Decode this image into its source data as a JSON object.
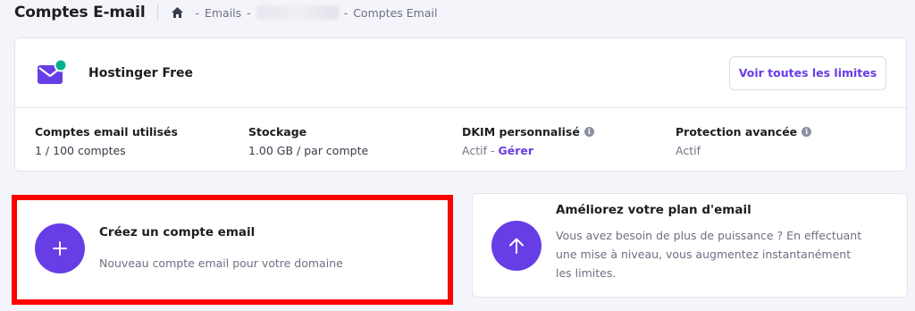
{
  "header": {
    "title": "Comptes E-mail",
    "breadcrumb": {
      "home_icon": "home-icon",
      "items": [
        "Emails",
        "Comptes Email"
      ],
      "separator": "-"
    }
  },
  "plan": {
    "icon": "mail-icon",
    "name": "Hostinger Free",
    "limits_button": "Voir toutes les limites",
    "stats": [
      {
        "label": "Comptes email utilisés",
        "value": "1 / 100 comptes"
      },
      {
        "label": "Stockage",
        "value": "1.00 GB / par compte"
      },
      {
        "label": "DKIM personnalisé",
        "value": "Actif",
        "link": "Gérer"
      },
      {
        "label": "Protection avancée",
        "value": "Actif"
      }
    ]
  },
  "create_card": {
    "icon": "plus-icon",
    "title": "Créez un compte email",
    "description": "Nouveau compte email pour votre domaine"
  },
  "upgrade_card": {
    "icon": "arrow-up-icon",
    "title": "Améliorez votre plan d'email",
    "description": "Vous avez besoin de plus de puissance ? En effectuant une mise à niveau, vous augmentez instantanément les limites."
  },
  "colors": {
    "accent": "#673de6",
    "highlight": "#ff0000",
    "background": "#f4f4fb",
    "notification_dot": "#00b090"
  }
}
